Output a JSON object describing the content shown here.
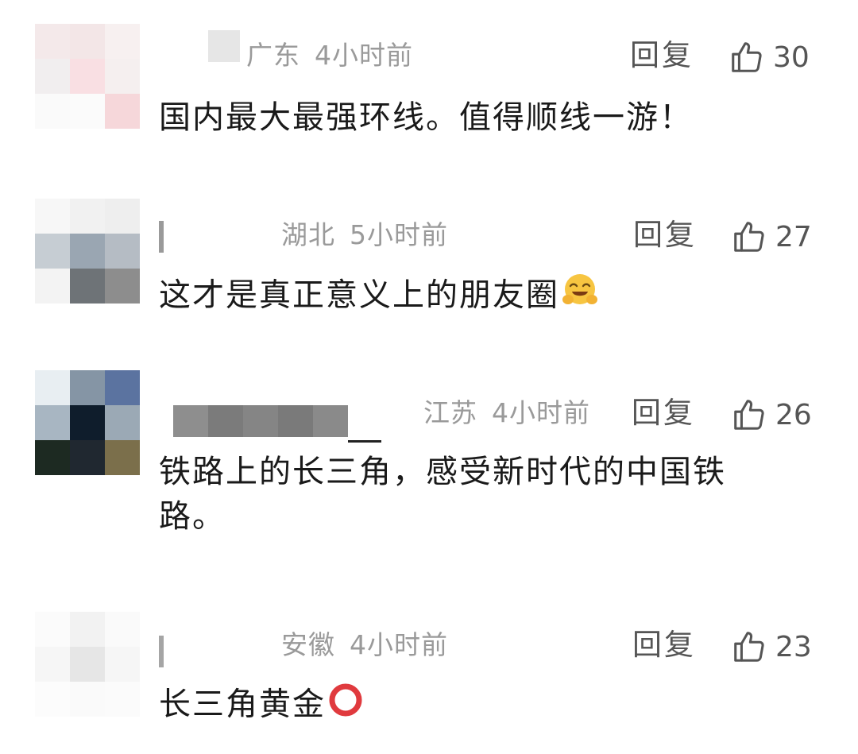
{
  "comments": [
    {
      "location": "广东",
      "time": "4小时前",
      "reply_label": "回复",
      "likes": "30",
      "text": "国内最大最强环线。值得顺线一游！",
      "emoji": ""
    },
    {
      "location": "湖北",
      "time": "5小时前",
      "reply_label": "回复",
      "likes": "27",
      "text": "这才是真正意义上的朋友圈",
      "emoji": "hugging-face-emoji"
    },
    {
      "location": "江苏",
      "time": "4小时前",
      "reply_label": "回复",
      "likes": "26",
      "text": "铁路上的长三角，感受新时代的中国铁路。",
      "emoji": ""
    },
    {
      "location": "安徽",
      "time": "4小时前",
      "reply_label": "回复",
      "likes": "23",
      "text": "长三角黄金",
      "emoji": "hollow-red-circle-emoji"
    }
  ],
  "icons": {
    "like": "thumbs-up-outline-icon"
  },
  "colors": {
    "meta_text": "#9a9a9a",
    "action_text": "#555555",
    "body_text": "#1a1a1a"
  }
}
